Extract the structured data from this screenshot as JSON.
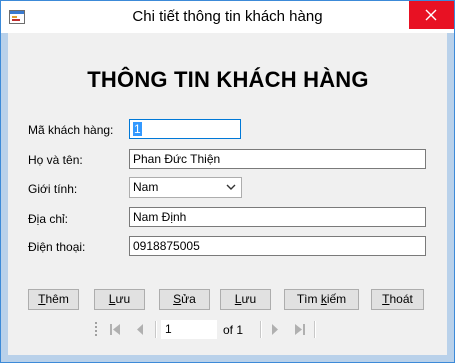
{
  "window": {
    "title": "Chi tiết thông tin khách hàng",
    "icon": "form-icon",
    "close_icon": "close-icon"
  },
  "form": {
    "heading": "THÔNG TIN KHÁCH HÀNG",
    "fields": {
      "customer_id": {
        "label": "Mã khách hàng:",
        "value": "1"
      },
      "full_name": {
        "label": "Họ và tên:",
        "value": "Phan Đức Thiện"
      },
      "gender": {
        "label": "Giới tính:",
        "value": "Nam"
      },
      "address": {
        "label": "Địa chỉ:",
        "value": "Nam Định"
      },
      "phone": {
        "label": "Điện thoại:",
        "value": "0918875005"
      }
    }
  },
  "buttons": {
    "add": {
      "prefix": "",
      "mnemonic": "T",
      "rest": "hêm"
    },
    "save1": {
      "prefix": "",
      "mnemonic": "L",
      "rest": "ưu"
    },
    "edit": {
      "prefix": "",
      "mnemonic": "S",
      "rest": "ửa"
    },
    "save2": {
      "prefix": "",
      "mnemonic": "L",
      "rest": "ưu"
    },
    "search": {
      "prefix": "Tìm ",
      "mnemonic": "k",
      "rest": "iếm"
    },
    "exit": {
      "prefix": "",
      "mnemonic": "T",
      "rest": "hoát"
    }
  },
  "navigator": {
    "position": "1",
    "count": "of 1"
  },
  "colors": {
    "window_border": "#3c8ad8",
    "close_button": "#e81123",
    "focus_border": "#0078d7",
    "selection": "#3399ff"
  }
}
